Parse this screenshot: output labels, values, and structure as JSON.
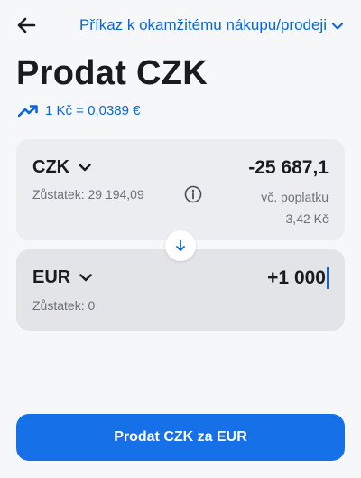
{
  "header": {
    "order_type_label": "Příkaz k okamžitému nákupu/prodeji"
  },
  "page": {
    "title": "Prodat CZK",
    "rate_text": "1 Kč = 0,0389 €"
  },
  "from": {
    "currency": "CZK",
    "balance": "Zůstatek: 29 194,09",
    "amount": "-25 687,1",
    "fee_line1": "vč. poplatku",
    "fee_line2": "3,42 Kč"
  },
  "to": {
    "currency": "EUR",
    "balance": "Zůstatek: 0",
    "amount": "+1 000"
  },
  "submit": {
    "label": "Prodat CZK za EUR"
  },
  "colors": {
    "accent": "#0a66d8",
    "button": "#1670e8",
    "background": "#f6f7f9"
  },
  "icons": [
    "back-arrow-icon",
    "chevron-down-icon",
    "trend-up-icon",
    "info-icon",
    "arrow-down-icon"
  ]
}
